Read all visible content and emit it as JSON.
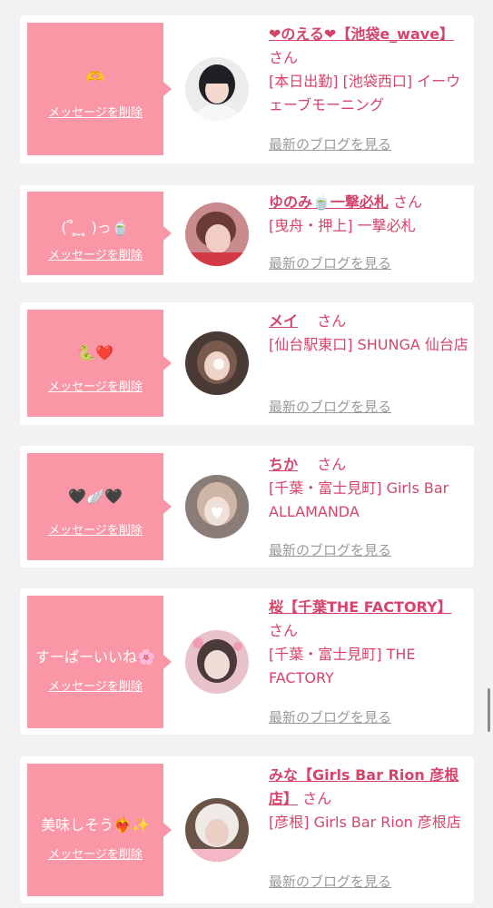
{
  "cards": [
    {
      "message": "🫶",
      "delete_label": "メッセージを削除",
      "name": "❤のえる❤【池袋e_wave】",
      "san": "さん",
      "area": "[本日出勤] [池袋西口] イーウェーブモーニング",
      "blog_label": "最新のブログを見る"
    },
    {
      "message": "(՞ ̥ ̮ ̥ )っ🍵",
      "delete_label": "メッセージを削除",
      "name": "ゆのみ🍵一撃必札",
      "san": "さん",
      "area": "[曳舟・押上] 一撃必札",
      "blog_label": "最新のブログを見る"
    },
    {
      "message": "🐍❤️",
      "delete_label": "メッセージを削除",
      "name": "メイ",
      "san": "さん",
      "area": "[仙台駅東口] SHUNGA 仙台店",
      "blog_label": "最新のブログを見る"
    },
    {
      "message": "🖤🪽🖤",
      "delete_label": "メッセージを削除",
      "name": "ちか",
      "san": "さん",
      "area": "[千葉・富士見町] Girls Bar ALLAMANDA",
      "blog_label": "最新のブログを見る"
    },
    {
      "message": "すーぱーいいね🌸",
      "delete_label": "メッセージを削除",
      "name": "桜【千葉THE FACTORY】",
      "san": "さん",
      "area": "[千葉・富士見町] THE FACTORY",
      "blog_label": "最新のブログを見る"
    },
    {
      "message": "美味しそう❤️‍🔥✨",
      "delete_label": "メッセージを削除",
      "name": "みな【Girls Bar Rion 彦根店】",
      "san": "さん",
      "area": "[彦根] Girls Bar Rion 彦根店",
      "blog_label": "最新のブログを見る"
    }
  ],
  "colors": {
    "bubble": "#fa97a6",
    "accent": "#d5446a",
    "link_gray": "#9a9a9a",
    "page_bg": "#f2f2f2"
  }
}
